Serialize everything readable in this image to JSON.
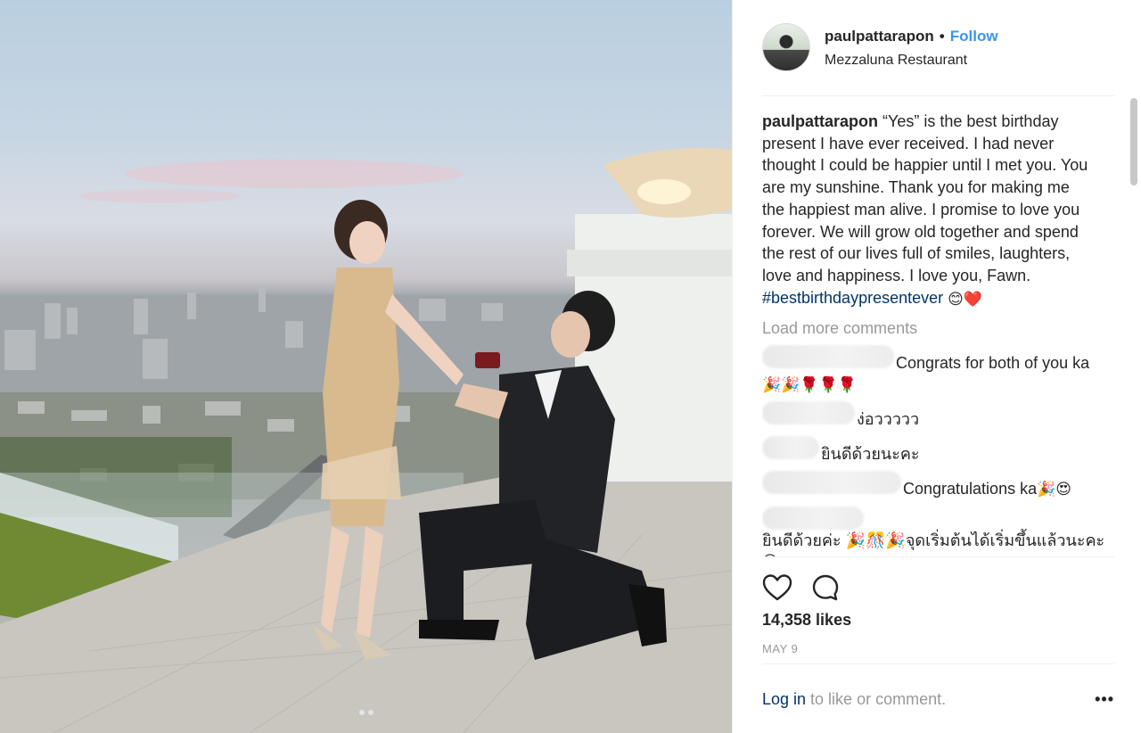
{
  "post": {
    "username": "paulpattarapon",
    "separator": "•",
    "follow_label": "Follow",
    "location": "Mezzaluna Restaurant",
    "avatar_icon": "profile-avatar",
    "accent_color": "#3897f0"
  },
  "caption": {
    "username": "paulpattarapon",
    "text": "“Yes” is the best birthday present I have ever received. I had never thought I could be happier until I met you. You are my sunshine. Thank you for making me the happiest man alive. I promise to love you forever. We will grow old together and spend the rest of our lives full of smiles, laughters, love and happiness. I love you, Fawn.",
    "hashtag": "#bestbirthdaypresentever",
    "emojis": "😊❤️"
  },
  "load_more_label": "Load more comments",
  "comments": [
    {
      "text": "Congrats for both of you ka",
      "emojis": "🎉🎉🌹🌹🌹"
    },
    {
      "text": "ง่อววววว",
      "emojis": ""
    },
    {
      "text": "ยินดีด้วยนะคะ",
      "emojis": ""
    },
    {
      "text": "Congratulations ka",
      "emojis": "🎉😍"
    },
    {
      "text": "ยินดีด้วยค่ะ 🎉🎊🎉จุดเริ่มต้นได้เริ่มขึ้นแล้วนะคะ",
      "emojis": "😍"
    }
  ],
  "actions": {
    "like_icon": "heart-icon",
    "comment_icon": "comment-bubble-icon"
  },
  "likes": "14,358 likes",
  "date": "MAY 9",
  "login": {
    "link": "Log in",
    "text": " to like or comment.",
    "more": "•••"
  },
  "carousel": {
    "count": 2,
    "active_index": 0
  }
}
